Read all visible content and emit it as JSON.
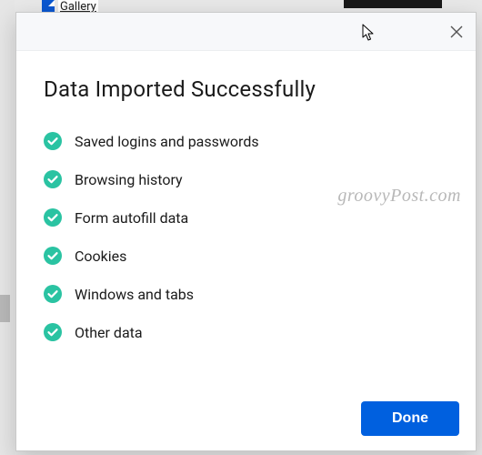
{
  "background": {
    "gallery_text": "Gallery"
  },
  "dialog": {
    "title": "Data Imported Successfully",
    "items": [
      {
        "label": "Saved logins and passwords"
      },
      {
        "label": "Browsing history"
      },
      {
        "label": "Form autofill data"
      },
      {
        "label": "Cookies"
      },
      {
        "label": "Windows and tabs"
      },
      {
        "label": "Other data"
      }
    ],
    "done_label": "Done"
  },
  "watermark": "groovyPost.com"
}
